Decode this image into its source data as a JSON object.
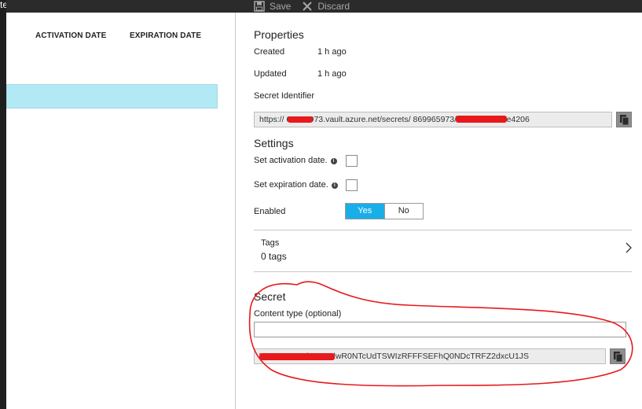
{
  "left_blade": {
    "title_fragment": "te",
    "columns": [
      "ACTIVATION DATE",
      "EXPIRATION DATE"
    ]
  },
  "toolbar": {
    "save_label": "Save",
    "discard_label": "Discard"
  },
  "properties": {
    "heading": "Properties",
    "created_label": "Created",
    "created_value": "1 h ago",
    "updated_label": "Updated",
    "updated_value": "1 h ago",
    "identifier_label": "Secret Identifier",
    "identifier_value": "https://       69965973.vault.azure.net/secrets/               869965973/e201d165bc4e4206"
  },
  "settings": {
    "heading": "Settings",
    "activation_label": "Set activation date.",
    "expiration_label": "Set expiration date.",
    "enabled_label": "Enabled",
    "enabled_yes": "Yes",
    "enabled_no": "No",
    "enabled_selected": "Yes"
  },
  "tags": {
    "title": "Tags",
    "count": "0 tags"
  },
  "secret": {
    "heading": "Secret",
    "content_type_label": "Content type (optional)",
    "content_type_value": "",
    "value_visible": "                       VFFRSUJBekNDQ3lwR0NTcUdTSWIzRFFFSEFhQ0NDcTRFZ2dxcU1JS"
  },
  "colors": {
    "accent": "#19aee8",
    "selected_row": "#b3e8f5",
    "toolbar_bg": "#2b2b2b",
    "annotation_red": "#e8191d"
  },
  "icons": {
    "save": "save-icon",
    "discard": "close-icon",
    "copy": "copy-icon",
    "info": "info-icon",
    "chevron": "chevron-right-icon"
  }
}
